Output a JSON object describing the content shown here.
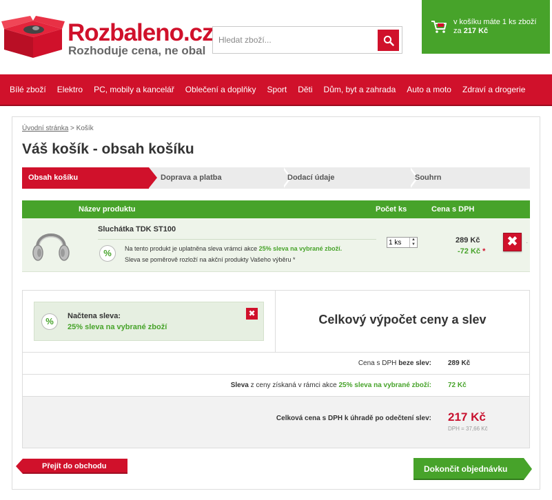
{
  "header": {
    "brand": "Rozbaleno.cz",
    "slogan": "Rozhoduje cena, ne obal",
    "search_placeholder": "Hledat zboží...",
    "cart": {
      "line1": "v košíku máte 1 ks zboží",
      "line2_prefix": "za",
      "line2_amount": "217 Kč"
    }
  },
  "nav": {
    "items": [
      "Bílé zboží",
      "Elektro",
      "PC, mobily a kancelář",
      "Oblečení a doplňky",
      "Sport",
      "Děti",
      "Dům, byt a zahrada",
      "Auto a moto",
      "Zdraví a drogerie"
    ]
  },
  "breadcrumb": {
    "home": "Úvodní stránka",
    "separator": ">",
    "current": "Košík"
  },
  "page_title": "Váš košík - obsah košíku",
  "steps": [
    "Obsah košíku",
    "Doprava a platba",
    "Dodací údaje",
    "Souhrn"
  ],
  "table": {
    "headers": {
      "product": "Název produktu",
      "qty": "Počet ks",
      "price": "Cena s DPH"
    },
    "item": {
      "name": "Sluchátka TDK ST100",
      "discount_text_prefix": "Na tento produkt je uplatněna sleva vrámci akce",
      "discount_name": "25% sleva na vybrané zboží.",
      "discount_note": "Sleva se poměrově rozloží na akční produkty Vašeho výběru *",
      "qty": "1 ks",
      "price": "289 Kč",
      "discount_amount": "-72 Kč",
      "asterisk": "*",
      "percent_symbol": "%",
      "remove_symbol": "✖"
    }
  },
  "summary": {
    "coupon_title": "Načtena sleva:",
    "coupon_value": "25% sleva na vybrané zboží",
    "coupon_remove_symbol": "✖",
    "calc_title": "Celkový výpočet ceny a slev",
    "row1": {
      "label_prefix": "Cena s DPH",
      "label_bold": "beze slev:",
      "value": "289 Kč"
    },
    "row2": {
      "label_bold": "Sleva",
      "label_mid": "z ceny získaná v rámci akce",
      "label_green": "25% sleva na vybrané zboží:",
      "value": "72 Kč"
    },
    "total": {
      "label": "Celková cena s DPH k úhradě po odečtení slev:",
      "value": "217 Kč",
      "vat_note": "DPH = 37,66 Kč"
    }
  },
  "buttons": {
    "back": "Přejít do obchodu",
    "finish": "Dokončit objednávku"
  },
  "colors": {
    "brand_red": "#d0112b",
    "brand_green": "#47a32a"
  }
}
